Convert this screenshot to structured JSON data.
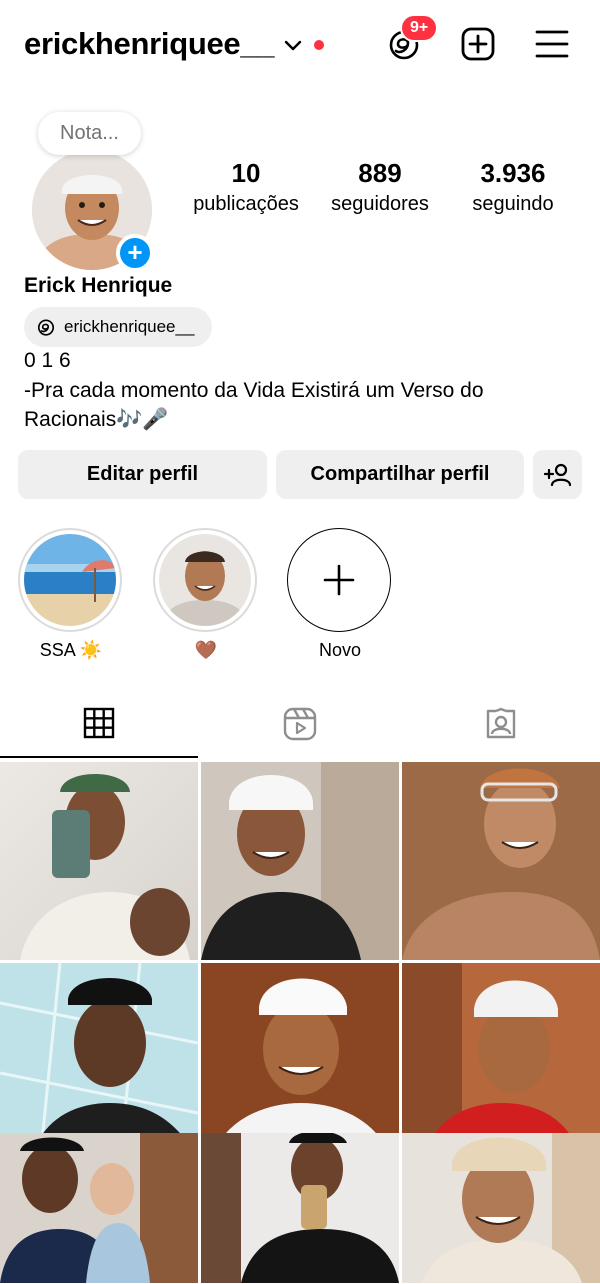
{
  "header": {
    "username": "erickhenriquee__",
    "threads_badge": "9+"
  },
  "profile": {
    "note_placeholder": "Nota...",
    "full_name": "Erick Henrique",
    "threads_handle": "erickhenriquee__",
    "bio_line1": "0 1 6",
    "bio_line2": "-Pra cada momento da Vida Existirá um Verso do",
    "bio_line3": "Racionais🎶🎤"
  },
  "stats": [
    {
      "value": "10",
      "label": "publicações"
    },
    {
      "value": "889",
      "label": "seguidores"
    },
    {
      "value": "3.936",
      "label": "seguindo"
    }
  ],
  "buttons": {
    "edit": "Editar perfil",
    "share": "Compartilhar perfil"
  },
  "highlights": [
    {
      "label": "SSA ☀️"
    },
    {
      "label": "🤎"
    },
    {
      "label": "Novo"
    }
  ],
  "colors": {
    "accent": "#0095f6",
    "notification": "#ff3040",
    "button_bg": "#efefef"
  }
}
